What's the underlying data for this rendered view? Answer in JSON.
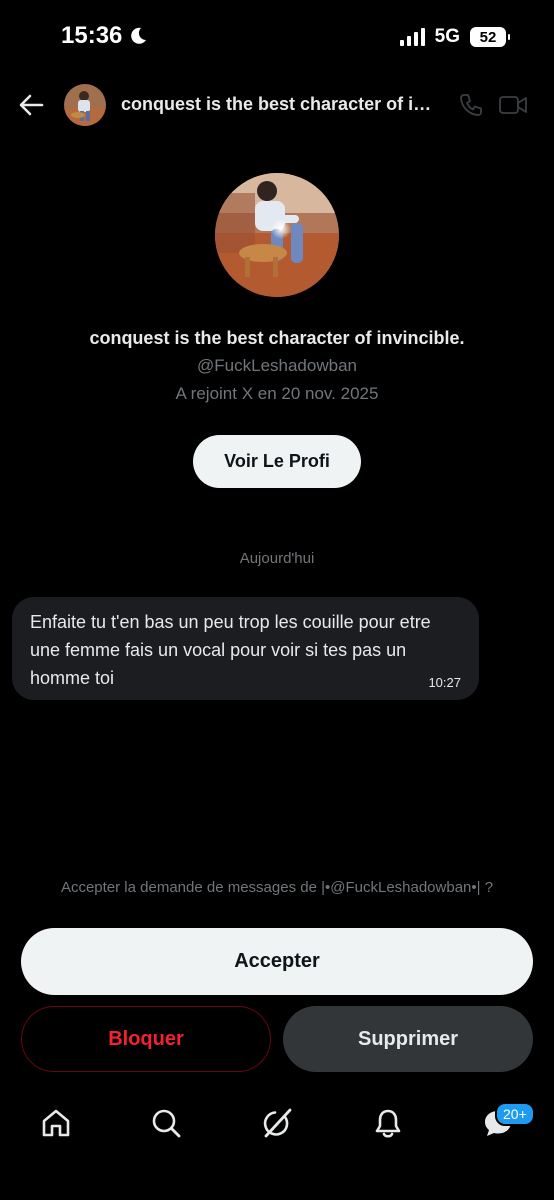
{
  "status_bar": {
    "time": "15:36",
    "network": "5G",
    "battery": "52"
  },
  "header": {
    "title": "conquest is the best character of invincible."
  },
  "profile": {
    "name": "conquest is the best character of invincible.",
    "handle": "@FuckLeshadowban",
    "joined": "A rejoint X en 20 nov. 2025",
    "button_label": "Voir Le Profi"
  },
  "conversation": {
    "date_separator": "Aujourd'hui",
    "messages": [
      {
        "text": "Enfaite tu t'en bas un peu trop les couille pour etre une femme fais un vocal pour voir si tes pas un homme toi",
        "time": "10:27"
      }
    ]
  },
  "request": {
    "prompt": "Accepter la demande de messages de |•@FuckLeshadowban•| ?",
    "accept_label": "Accepter",
    "block_label": "Bloquer",
    "delete_label": "Supprimer"
  },
  "bottom_nav": {
    "items": [
      "home-icon",
      "search-icon",
      "grok-icon",
      "notifications-icon",
      "messages-icon"
    ],
    "messages_badge": "20+"
  },
  "colors": {
    "background": "#000000",
    "accent": "#1d9bf0",
    "danger": "#f4212e",
    "muted": "#71767b"
  }
}
